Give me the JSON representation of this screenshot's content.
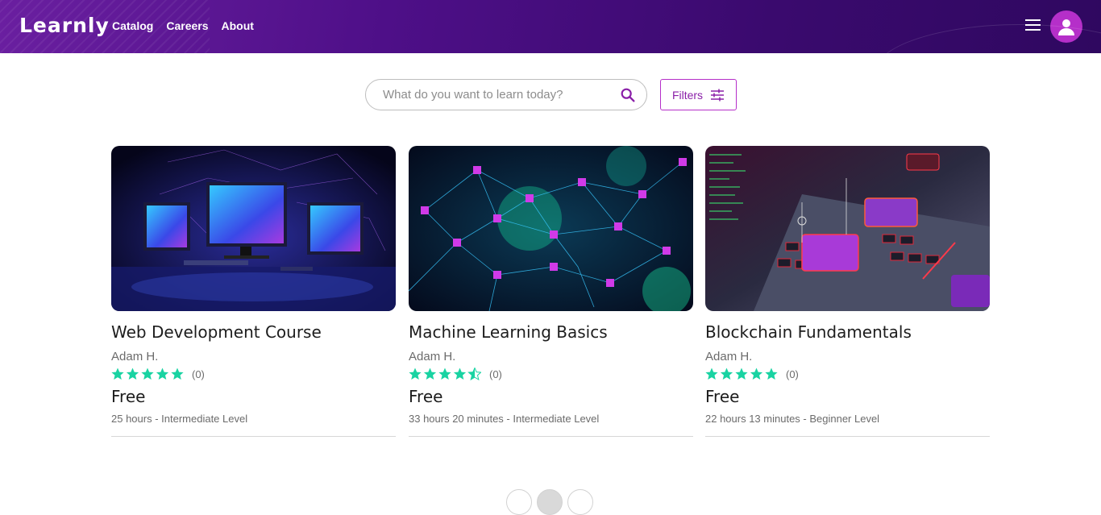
{
  "header": {
    "logo": "Learnly",
    "nav": [
      "Catalog",
      "Careers",
      "About"
    ]
  },
  "search": {
    "placeholder": "What do you want to learn today?"
  },
  "filters": {
    "label": "Filters"
  },
  "colors": {
    "brand_purple": "#4e0f88",
    "accent": "#b52fc9",
    "star": "#19d3a2"
  },
  "courses": [
    {
      "title": "Web Development Course",
      "author": "Adam H.",
      "rating": 5,
      "reviews": "(0)",
      "price": "Free",
      "meta": "25 hours - Intermediate Level"
    },
    {
      "title": "Machine Learning Basics",
      "author": "Adam H.",
      "rating": 4.5,
      "reviews": "(0)",
      "price": "Free",
      "meta": "33 hours 20 minutes - Intermediate Level"
    },
    {
      "title": "Blockchain Fundamentals",
      "author": "Adam H.",
      "rating": 5,
      "reviews": "(0)",
      "price": "Free",
      "meta": "22 hours 13 minutes - Beginner Level"
    }
  ]
}
